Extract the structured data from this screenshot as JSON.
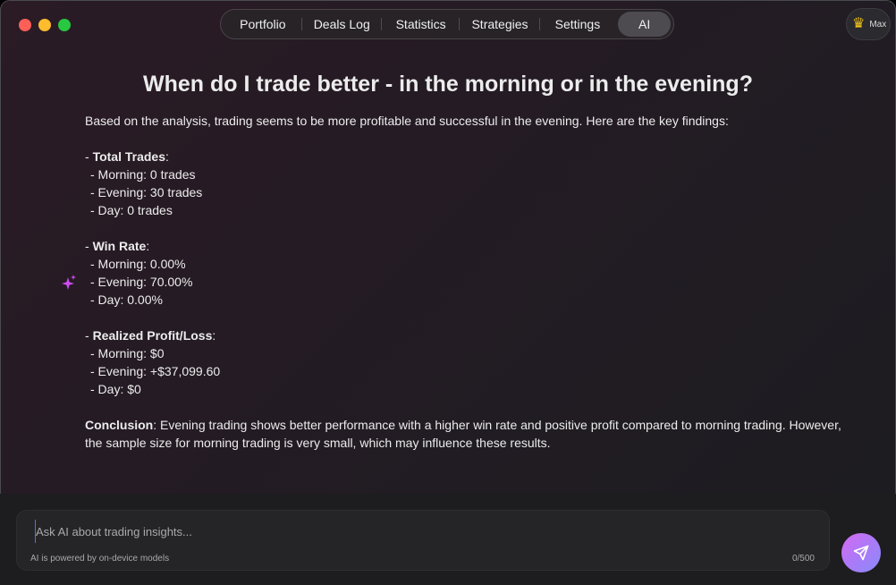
{
  "nav": {
    "items": [
      {
        "label": "Portfolio"
      },
      {
        "label": "Deals Log"
      },
      {
        "label": "Statistics"
      },
      {
        "label": "Strategies"
      },
      {
        "label": "Settings"
      },
      {
        "label": "AI",
        "active": true
      }
    ]
  },
  "account": {
    "name": "Max",
    "icon": "crown-icon"
  },
  "page": {
    "title": "When do I trade better - in the morning or in the evening?"
  },
  "answer": {
    "intro": "Based on the analysis, trading seems to be more profitable and successful in the evening. Here are the key findings:",
    "sections": [
      {
        "prefix": "- ",
        "heading": "Total Trades",
        "suffix": ":",
        "lines": [
          "- Morning: 0 trades",
          "- Evening: 30 trades",
          "- Day: 0 trades"
        ]
      },
      {
        "prefix": "- ",
        "heading": "Win Rate",
        "suffix": ":",
        "lines": [
          "- Morning: 0.00%",
          "- Evening: 70.00%",
          "- Day: 0.00%"
        ]
      },
      {
        "prefix": "- ",
        "heading": "Realized Profit/Loss",
        "suffix": ":",
        "lines": [
          "- Morning: $0",
          "- Evening: +$37,099.60",
          "- Day: $0"
        ]
      }
    ],
    "conclusion_label": "Conclusion",
    "conclusion_text": ": Evening trading shows better performance with a higher win rate and positive profit compared to morning trading. However, the sample size for morning trading is very small, which may influence these results."
  },
  "input": {
    "placeholder": "Ask AI about trading insights...",
    "value": "",
    "powered_by": "AI is powered by on-device models",
    "counter": "0/500"
  },
  "colors": {
    "accent_gradient_start": "#d66bf2",
    "accent_gradient_end": "#8c8cfa",
    "sparkle": "#d24bf5"
  }
}
